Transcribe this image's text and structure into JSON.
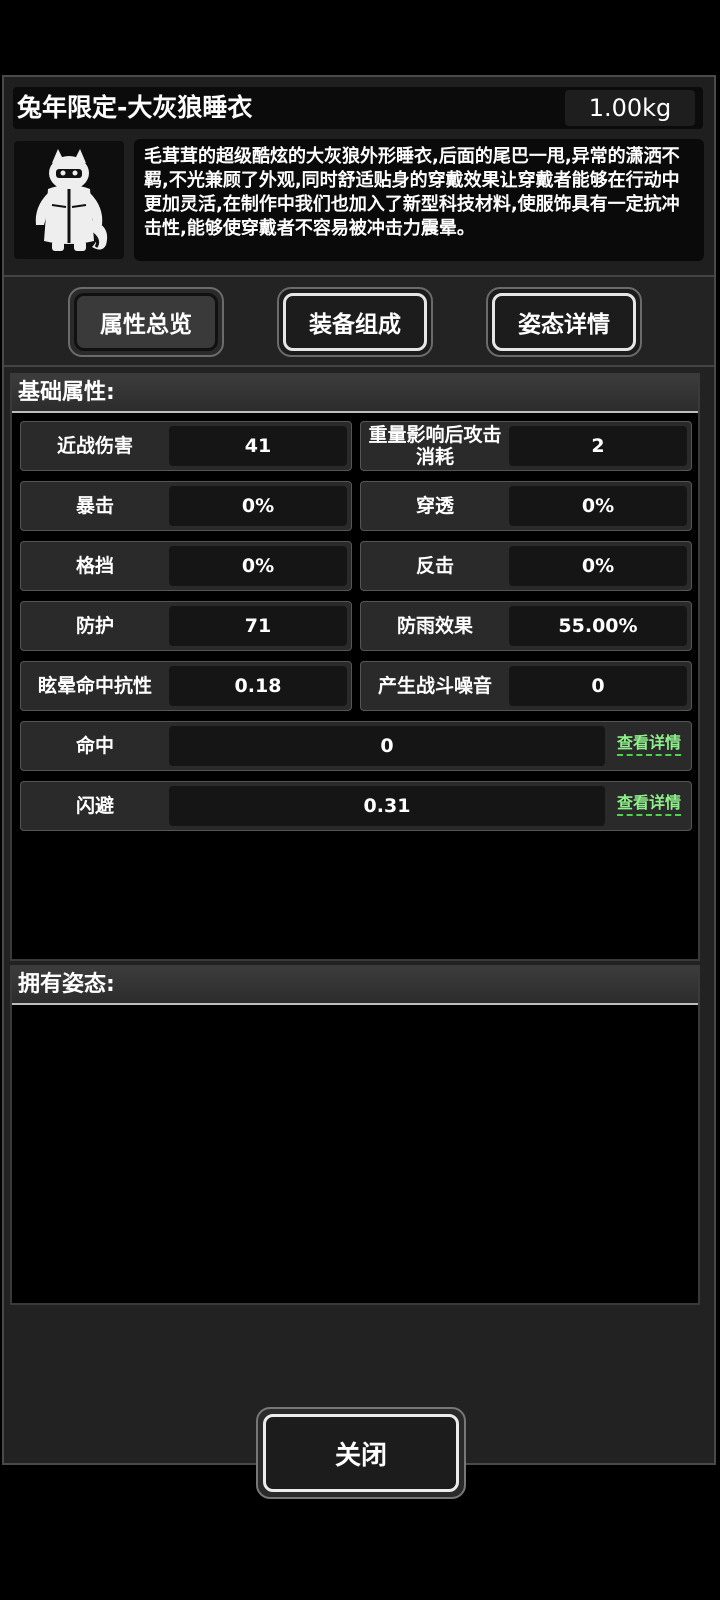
{
  "item": {
    "title": "兔年限定-大灰狼睡衣",
    "weight": "1.00kg",
    "description": "毛茸茸的超级酷炫的大灰狼外形睡衣,后面的尾巴一甩,异常的潇洒不羁,不光兼顾了外观,同时舒适贴身的穿戴效果让穿戴者能够在行动中更加灵活,在制作中我们也加入了新型科技材料,使服饰具有一定抗冲击性,能够使穿戴者不容易被冲击力震晕。",
    "icon": "wolf-pajamas-icon"
  },
  "tabs": [
    {
      "label": "属性总览",
      "active": true
    },
    {
      "label": "装备组成",
      "active": false
    },
    {
      "label": "姿态详情",
      "active": false
    }
  ],
  "basic": {
    "title": "基础属性:",
    "pairs": [
      [
        {
          "label": "近战伤害",
          "value": "41"
        },
        {
          "label": "重量影响后攻击消耗",
          "value": "2"
        }
      ],
      [
        {
          "label": "暴击",
          "value": "0%"
        },
        {
          "label": "穿透",
          "value": "0%"
        }
      ],
      [
        {
          "label": "格挡",
          "value": "0%"
        },
        {
          "label": "反击",
          "value": "0%"
        }
      ],
      [
        {
          "label": "防护",
          "value": "71"
        },
        {
          "label": "防雨效果",
          "value": "55.00%"
        }
      ],
      [
        {
          "label": "眩晕命中抗性",
          "value": "0.18"
        },
        {
          "label": "产生战斗噪音",
          "value": "0"
        }
      ]
    ],
    "wide": [
      {
        "label": "命中",
        "value": "0",
        "link": "查看详情"
      },
      {
        "label": "闪避",
        "value": "0.31",
        "link": "查看详情"
      }
    ]
  },
  "stances": {
    "title": "拥有姿态:"
  },
  "close_label": "关闭",
  "colors": {
    "link": "#8ef08a",
    "background": "#000000",
    "panel": "#222222"
  }
}
